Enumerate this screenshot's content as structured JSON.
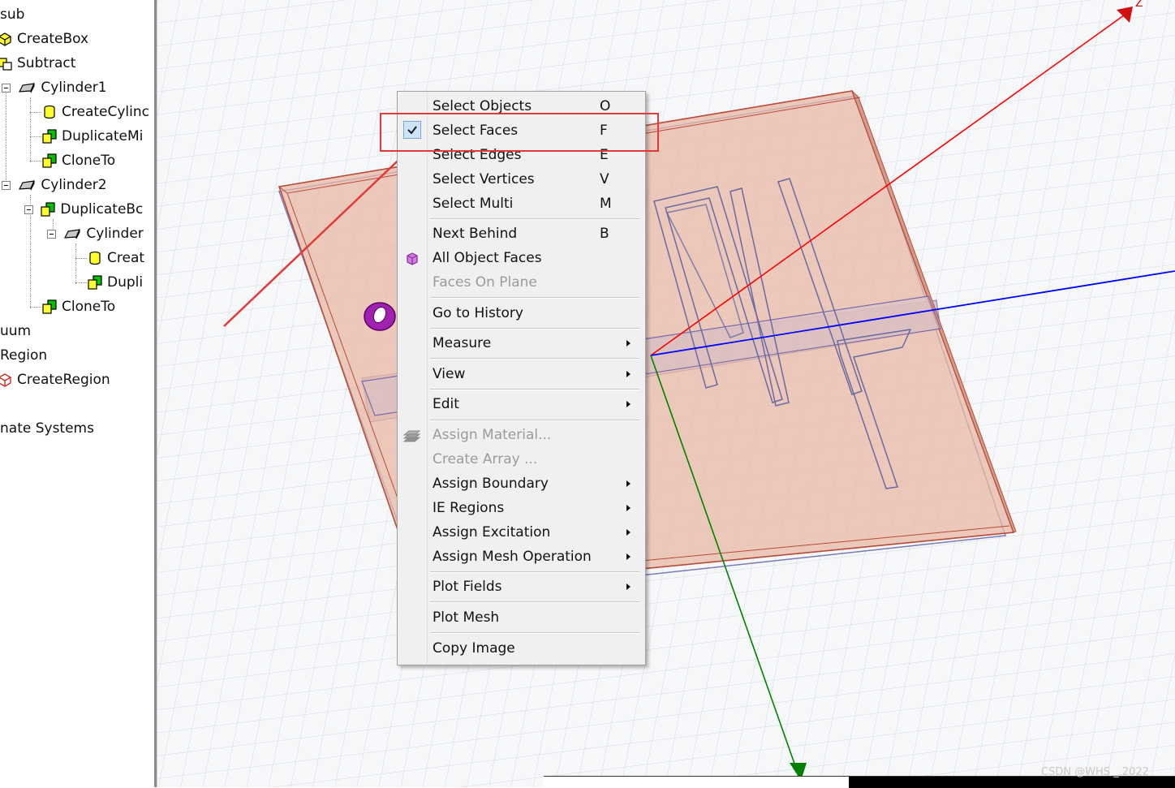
{
  "tree": {
    "items": [
      {
        "label": "sub"
      },
      {
        "label": "CreateBox"
      },
      {
        "label": "Subtract"
      },
      {
        "label": "Cylinder1"
      },
      {
        "label": "CreateCylinc"
      },
      {
        "label": "DuplicateMi"
      },
      {
        "label": "CloneTo"
      },
      {
        "label": "Cylinder2"
      },
      {
        "label": "DuplicateBc"
      },
      {
        "label": "Cylinder"
      },
      {
        "label": "Creat"
      },
      {
        "label": "Dupli"
      },
      {
        "label": "CloneTo"
      },
      {
        "label": "uum"
      },
      {
        "label": "Region"
      },
      {
        "label": "CreateRegion"
      },
      {
        "label": "nate Systems"
      }
    ]
  },
  "viewport": {
    "axis_label_z": "Z",
    "colors": {
      "grid": "#d2d6de",
      "substrate_fill": "#e8b8a6",
      "substrate_edge": "#b84a3a",
      "ground_edge": "#5a5aa8",
      "axis_x_red": "#ff0000",
      "axis_y_blue": "#0000ff",
      "axis_z_green": "#008000",
      "port_purple": "#a020b0"
    }
  },
  "context_menu": {
    "items": [
      {
        "label": "Select Objects",
        "mnemonic_index": 7,
        "shortcut": "O",
        "enabled": true
      },
      {
        "label": "Select Faces",
        "mnemonic_index": 7,
        "shortcut": "F",
        "enabled": true,
        "checked": true
      },
      {
        "label": "Select Edges",
        "mnemonic_index": 7,
        "shortcut": "E",
        "enabled": true
      },
      {
        "label": "Select Vertices",
        "mnemonic_index": 7,
        "shortcut": "V",
        "enabled": true
      },
      {
        "label": "Select Multi",
        "mnemonic_index": 7,
        "shortcut": "M",
        "enabled": true
      },
      {
        "label": "Next Behind",
        "mnemonic_index": 5,
        "shortcut": "B",
        "enabled": true
      },
      {
        "label": "All Object Faces",
        "mnemonic_index": 4,
        "shortcut": "",
        "enabled": true,
        "icon": "cube-icon"
      },
      {
        "label": "Faces On Plane",
        "mnemonic_index": 0,
        "shortcut": "",
        "enabled": false
      },
      {
        "label": "Go to History",
        "mnemonic_index": 0,
        "shortcut": "",
        "enabled": true
      },
      {
        "label": "Measure",
        "mnemonic_index": 0,
        "submenu": true,
        "enabled": true
      },
      {
        "label": "View",
        "mnemonic_index": 0,
        "submenu": true,
        "enabled": true
      },
      {
        "label": "Edit",
        "mnemonic_index": 0,
        "submenu": true,
        "enabled": true
      },
      {
        "label": "Assign Material...",
        "mnemonic_index": 0,
        "enabled": false,
        "icon": "material-icon"
      },
      {
        "label": "Create Array ...",
        "mnemonic_index": 7,
        "enabled": false
      },
      {
        "label": "Assign Boundary",
        "submenu": true,
        "enabled": true
      },
      {
        "label": "IE Regions",
        "mnemonic_index": 0,
        "submenu": true,
        "enabled": true
      },
      {
        "label": "Assign Excitation",
        "submenu": true,
        "enabled": true
      },
      {
        "label": "Assign Mesh Operation",
        "submenu": true,
        "enabled": true
      },
      {
        "label": "Plot Fields",
        "submenu": true,
        "enabled": true
      },
      {
        "label": "Plot Mesh",
        "enabled": true
      },
      {
        "label": "Copy Image",
        "mnemonic_index": 0,
        "enabled": true
      }
    ]
  },
  "annotation": {
    "color": "#e23a3a"
  },
  "watermark": "CSDN @WHS _ 2022"
}
